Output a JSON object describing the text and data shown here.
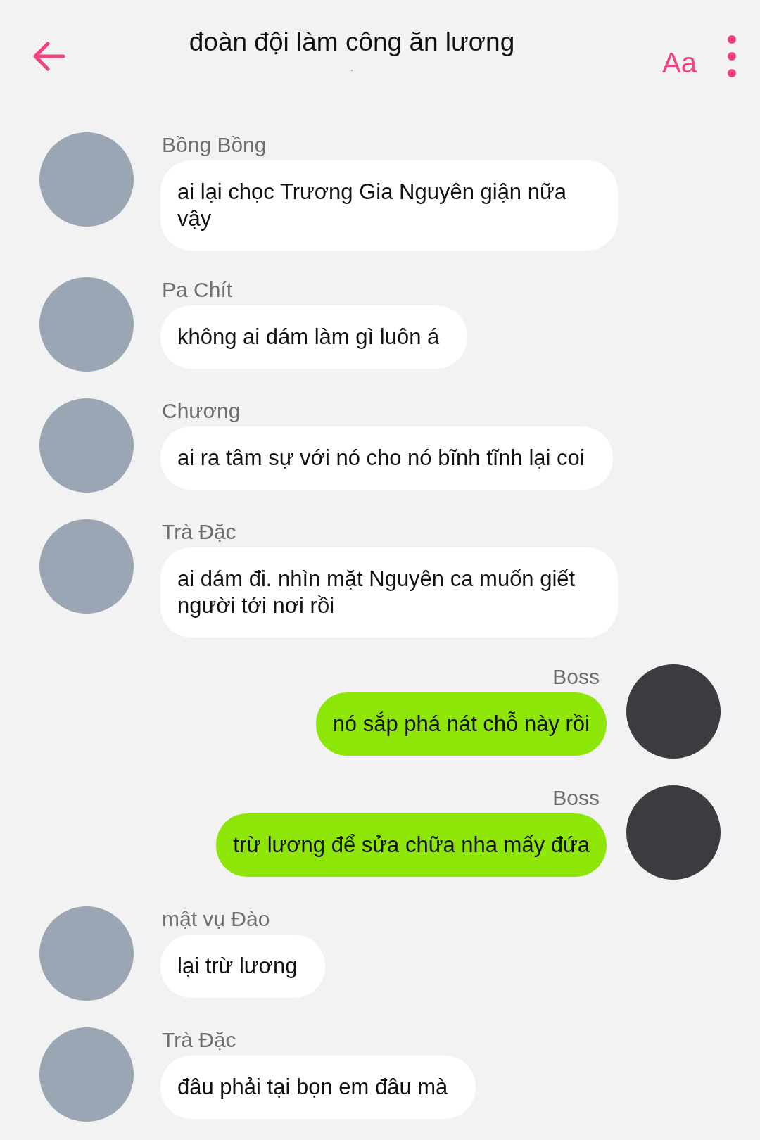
{
  "header": {
    "title": "đoàn đội làm công ăn lương",
    "subtitle": ".",
    "font_button": "Aa"
  },
  "messages": [
    {
      "kind": "incoming",
      "sender": "Bồng Bồng",
      "text": "ai lại chọc Trương Gia Nguyên giận nữa vậy"
    },
    {
      "kind": "incoming",
      "sender": "Pa Chít",
      "text": "không ai dám làm gì luôn á"
    },
    {
      "kind": "incoming",
      "sender": "Chương",
      "text": "ai ra tâm sự với nó cho nó bĩnh tĩnh lại coi"
    },
    {
      "kind": "incoming",
      "sender": "Trà Đặc",
      "text": "ai dám đi. nhìn mặt Nguyên ca muốn giết người tới nơi rồi"
    },
    {
      "kind": "outgoing",
      "sender": "Boss",
      "text": "nó sắp phá nát chỗ này rồi"
    },
    {
      "kind": "outgoing",
      "sender": "Boss",
      "text": "trừ lương để sửa chữa nha mấy đứa"
    },
    {
      "kind": "incoming",
      "sender": "mật vụ Đào",
      "text": "lại trừ lương"
    },
    {
      "kind": "incoming",
      "sender": "Trà Đặc",
      "text": "đâu phải tại bọn em đâu mà"
    }
  ]
}
